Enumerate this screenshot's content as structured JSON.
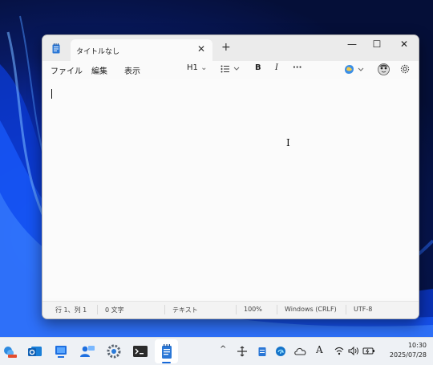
{
  "window": {
    "tab_title": "タイトルなし",
    "tab_close": "✕",
    "new_tab": "+",
    "minimize": "—",
    "maximize": "☐",
    "close": "✕"
  },
  "menu": {
    "file": "ファイル",
    "edit": "編集",
    "view": "表示"
  },
  "toolbar": {
    "heading": "H1",
    "bold": "B",
    "italic": "I",
    "more": "···",
    "dropdown_chevron": "⌄"
  },
  "editor": {
    "content": "",
    "pointer": "I"
  },
  "status": {
    "position": "行 1、列 1",
    "chars": "0 文字",
    "format": "テキスト",
    "zoom": "100%",
    "line_ending": "Windows (CRLF)",
    "encoding": "UTF-8"
  },
  "taskbar": {
    "apps": [
      "weather-icon",
      "outlook-icon",
      "widgets-icon",
      "people-icon",
      "settings-icon",
      "terminal-icon",
      "notepad-icon"
    ],
    "tray": {
      "chevron": "^",
      "tray_icons": [
        "remote-icon",
        "notepad-tray-icon",
        "edge-icon",
        "onedrive-icon",
        "font-icon",
        "wifi-icon",
        "volume-icon",
        "battery-icon"
      ],
      "font_glyph": "A"
    },
    "clock_time": "10:30",
    "clock_date": "2025/07/28"
  },
  "colors": {
    "accent": "#1668d8",
    "window_bg": "#fafafa",
    "titlebar_bg": "#ebebeb"
  }
}
